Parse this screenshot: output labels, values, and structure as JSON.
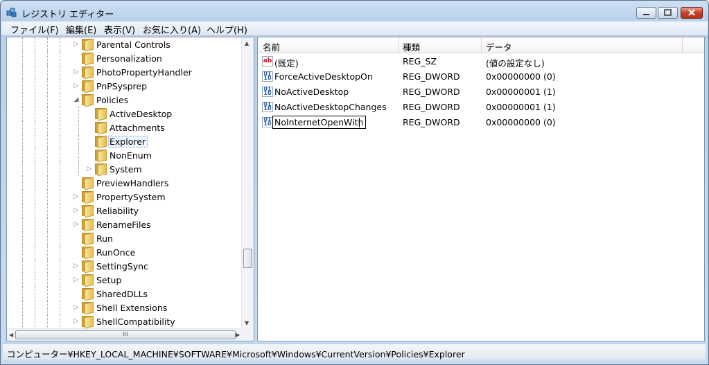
{
  "window": {
    "title": "レジストリ エディター",
    "minimize_label": "",
    "maximize_label": "",
    "close_label": ""
  },
  "menu": [
    {
      "label": "ファイル(F)"
    },
    {
      "label": "編集(E)"
    },
    {
      "label": "表示(V)"
    },
    {
      "label": "お気に入り(A)"
    },
    {
      "label": "ヘルプ(H)"
    }
  ],
  "tree": {
    "items": [
      {
        "label": "Parental Controls",
        "expander": "▷"
      },
      {
        "label": "Personalization",
        "expander": ""
      },
      {
        "label": "PhotoPropertyHandler",
        "expander": "▷"
      },
      {
        "label": "PnPSysprep",
        "expander": "▷"
      },
      {
        "label": "Policies",
        "expander": "◢"
      },
      {
        "label": "ActiveDesktop",
        "expander": ""
      },
      {
        "label": "Attachments",
        "expander": ""
      },
      {
        "label": "Explorer",
        "expander": "",
        "selected": true
      },
      {
        "label": "NonEnum",
        "expander": ""
      },
      {
        "label": "System",
        "expander": "▷"
      },
      {
        "label": "PreviewHandlers",
        "expander": ""
      },
      {
        "label": "PropertySystem",
        "expander": "▷"
      },
      {
        "label": "Reliability",
        "expander": "▷"
      },
      {
        "label": "RenameFiles",
        "expander": "▷"
      },
      {
        "label": "Run",
        "expander": ""
      },
      {
        "label": "RunOnce",
        "expander": ""
      },
      {
        "label": "SettingSync",
        "expander": "▷"
      },
      {
        "label": "Setup",
        "expander": "▷"
      },
      {
        "label": "SharedDLLs",
        "expander": ""
      },
      {
        "label": "Shell Extensions",
        "expander": "▷"
      },
      {
        "label": "ShellCompatibility",
        "expander": "▷"
      }
    ],
    "hscroll_thumb": "III"
  },
  "list": {
    "columns": {
      "name": "名前",
      "type": "種類",
      "data": "データ"
    },
    "rows": [
      {
        "name": "(既定)",
        "type": "REG_SZ",
        "data": "(値の設定なし)",
        "icon": "string-value-icon"
      },
      {
        "name": "ForceActiveDesktopOn",
        "type": "REG_DWORD",
        "data": "0x00000000 (0)",
        "icon": "dword-value-icon"
      },
      {
        "name": "NoActiveDesktop",
        "type": "REG_DWORD",
        "data": "0x00000001 (1)",
        "icon": "dword-value-icon"
      },
      {
        "name": "NoActiveDesktopChanges",
        "type": "REG_DWORD",
        "data": "0x00000001 (1)",
        "icon": "dword-value-icon"
      },
      {
        "name": "NoInternetOpenWith",
        "type": "REG_DWORD",
        "data": "0x00000000 (0)",
        "icon": "dword-value-icon",
        "editing": true
      }
    ]
  },
  "status": {
    "path": "コンピューター¥HKEY_LOCAL_MACHINE¥SOFTWARE¥Microsoft¥Windows¥CurrentVersion¥Policies¥Explorer"
  }
}
